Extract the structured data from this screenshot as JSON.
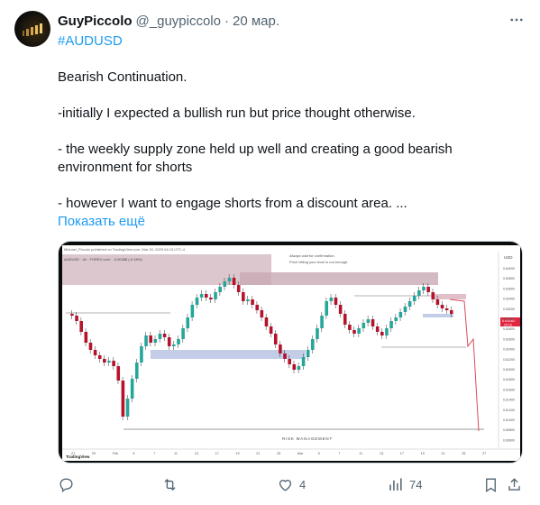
{
  "post": {
    "author_name": "GuyPiccolo",
    "author_handle": "@_guypiccolo",
    "separator": "·",
    "date": "20 мар.",
    "hashtag": "#AUDUSD",
    "paragraphs": [
      "Bearish Continuation.",
      "-initially I expected a bullish run but price thought otherwise.",
      "- the weekly supply zone held up well and creating a good bearish environment for shorts",
      "- however I want to engage shorts from a discount area. ..."
    ],
    "show_more": "Показать ещё"
  },
  "media": {
    "top_line": "Michael_Piccolo published on TradingView.com, Mar 20, 2025 04:15 UTC-4",
    "symbol_line": "AUDUSD · 4h · FOREX.com · -0.00288 (-0.45%)",
    "note_line1": "Always wait for confirmation.",
    "note_line2": "Price hitting your level is not enough.",
    "risk_label": "RISK MANAGEMENT",
    "currency": "USD",
    "price_badge": "0.63162",
    "price_badge_sub": "20:19",
    "logo": "TradingView",
    "x_ticks": [
      "27",
      "29",
      "Feb",
      "5",
      "7",
      "11",
      "13",
      "17",
      "19",
      "21",
      "25",
      "Mar",
      "5",
      "7",
      "11",
      "13",
      "17",
      "19",
      "21",
      "25",
      "27"
    ],
    "y_ticks": [
      "0.64000",
      "0.63800",
      "0.63600",
      "0.63400",
      "0.63200",
      "0.63000",
      "0.62800",
      "0.62600",
      "0.62400",
      "0.62200",
      "0.62000",
      "0.61800",
      "0.61600",
      "0.61400",
      "0.61200",
      "0.61000",
      "0.60800",
      "0.60600"
    ]
  },
  "actions": {
    "reply_count": "",
    "retweet_count": "",
    "like_count": "4",
    "views_count": "74"
  },
  "colors": {
    "accent": "#1d9bf0",
    "muted": "#536471",
    "bull": "#26a69a",
    "bear": "#b5122c",
    "supply_zone": "#c9a9b4",
    "demand_zone": "#b8c4e4"
  }
}
